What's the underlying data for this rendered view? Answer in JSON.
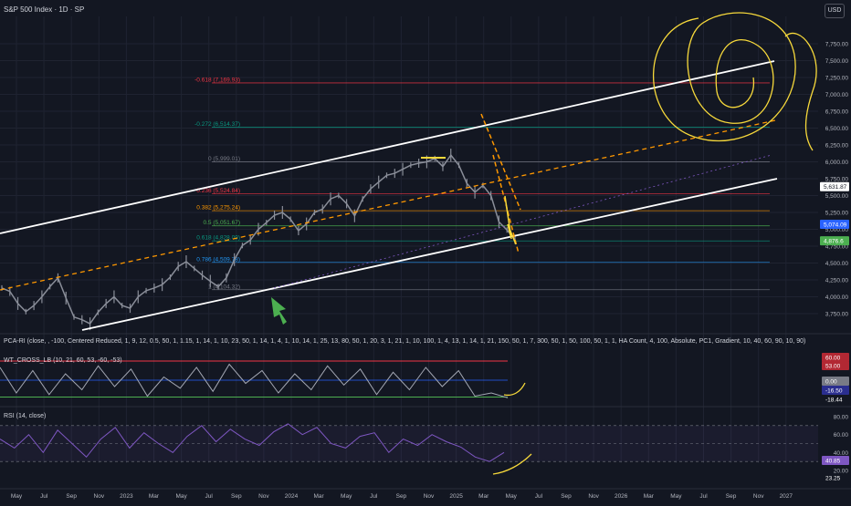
{
  "header": {
    "title": "S&P 500 Index · 1D · SP",
    "currency": "USD"
  },
  "chart_data": [
    {
      "type": "line",
      "title": "S&P 500 Index · 1D · SP",
      "x_ticks": [
        "May",
        "Jul",
        "Sep",
        "Nov",
        "2023",
        "Mar",
        "May",
        "Jul",
        "Sep",
        "Nov",
        "2024",
        "Mar",
        "May",
        "Jul",
        "Sep",
        "Nov",
        "2025",
        "Mar",
        "May",
        "Jul",
        "Sep",
        "Nov",
        "2026",
        "Mar",
        "May",
        "Jul",
        "Sep",
        "Nov",
        "2027"
      ],
      "y_ticks": [
        "7,750.00",
        "7,500.00",
        "7,250.00",
        "7,000.00",
        "6,750.00",
        "6,500.00",
        "6,250.00",
        "6,000.00",
        "5,750.00",
        "5,500.00",
        "5,250.00",
        "5,000.00",
        "4,750.00",
        "4,500.00",
        "4,250.00",
        "4,000.00",
        "3,750.00"
      ],
      "ylim": [
        3600,
        8050
      ],
      "series": [
        {
          "values": [
            4130,
            4080,
            3900,
            3780,
            3870,
            4000,
            4150,
            4280,
            3980,
            3700,
            3660,
            3600,
            3770,
            3900,
            4000,
            3870,
            3830,
            4000,
            4090,
            4130,
            4180,
            4290,
            4450,
            4520,
            4420,
            4320,
            4230,
            4150,
            4280,
            4550,
            4760,
            4840,
            5000,
            5100,
            5210,
            5250,
            5150,
            4980,
            5080,
            5250,
            5300,
            5450,
            5500,
            5380,
            5200,
            5450,
            5600,
            5700,
            5800,
            5830,
            5890,
            5950,
            5980,
            6000,
            6050,
            5930,
            6100,
            5950,
            5680,
            5550,
            5650,
            5500,
            5110,
            4990,
            4850
          ]
        }
      ],
      "fib_levels": [
        {
          "label": "-0.618 (7,169.93)",
          "value": 7169.93,
          "color": "#f23645"
        },
        {
          "label": "-0.272 (6,514.37)",
          "value": 6514.37,
          "color": "#089981"
        },
        {
          "label": "0 (5,999.01)",
          "value": 5999.01,
          "color": "#787b86"
        },
        {
          "label": "0.236 (5,524.84)",
          "value": 5524.84,
          "color": "#f23645"
        },
        {
          "label": "0.382 (5,275.24)",
          "value": 5275.24,
          "color": "#ff9800"
        },
        {
          "label": "0.5 (5,051.67)",
          "value": 5051.67,
          "color": "#4caf50"
        },
        {
          "label": "0.618 (4,828.09)",
          "value": 4828.09,
          "color": "#089981"
        },
        {
          "label": "0.786 (4,509.78)",
          "value": 4509.78,
          "color": "#2196f3"
        },
        {
          "label": "1 (4,104.32)",
          "value": 4104.32,
          "color": "#787b86"
        }
      ],
      "price_tags": [
        {
          "label": "5,631.87",
          "value": 5631.87,
          "bg": "#ffffff",
          "fg": "#131722"
        },
        {
          "label": "5,074.09",
          "value": 5074.09,
          "bg": "#2962ff",
          "fg": "#ffffff"
        },
        {
          "label": "4,876.6",
          "value": 4830,
          "bg": "#4caf50",
          "fg": "#ffffff"
        }
      ]
    },
    {
      "type": "line",
      "title": "WT_CROSS_LB (10, 21, 60, 53, -60, -53)",
      "levels": [
        60,
        53,
        0,
        -60,
        -53
      ],
      "series": [
        {
          "values": [
            40,
            -40,
            30,
            -45,
            20,
            -30,
            45,
            -20,
            35,
            -50,
            10,
            -25,
            40,
            -35,
            50,
            -10,
            30,
            -40,
            20,
            -30,
            45,
            -15,
            35,
            -45,
            25,
            -30,
            40,
            -20,
            30,
            -50,
            -40,
            -55
          ]
        }
      ],
      "tags": [
        {
          "label": "60.00",
          "bg": "#b22833"
        },
        {
          "label": "53.00",
          "bg": "#b22833"
        },
        {
          "label": "0.00",
          "bg": "#787b86"
        },
        {
          "label": "-16.50",
          "bg": "#2a2e8f"
        },
        {
          "label": "-18.44",
          "bg": "#131722"
        }
      ]
    },
    {
      "type": "line",
      "title": "RSI (14, close)",
      "y_ticks": [
        "80.00",
        "60.00",
        "40.00",
        "20.00"
      ],
      "ylim": [
        15,
        90
      ],
      "series": [
        {
          "values": [
            55,
            45,
            60,
            40,
            65,
            50,
            35,
            55,
            68,
            45,
            62,
            50,
            40,
            58,
            70,
            52,
            66,
            55,
            48,
            63,
            72,
            60,
            68,
            50,
            45,
            58,
            62,
            40,
            55,
            48,
            60,
            52,
            46,
            35,
            30,
            40
          ]
        }
      ],
      "tags": [
        {
          "label": "40.85",
          "bg": "#7e57c2"
        },
        {
          "label": "23.25",
          "bg": "#131722"
        }
      ]
    }
  ],
  "indicator_line": "PCA-RI (close, , -100, Centered Reduced, 1, 9, 12, 0.5, 50, 1, 1.15, 1, 14, 1, 10, 23, 50, 1, 14, 1, 4, 1, 10, 14, 1, 25, 13, 80, 50, 1, 20, 3, 1, 21, 1, 10, 100, 1, 4, 13, 1, 14, 1, 21, 150, 50, 1, 7, 300, 50, 1, 50, 100, 50, 1, 1, HA Count, 4, 100, Absolute, PC1, Gradient, 10, 40, 60, 90, 10, 90)",
  "colors": {
    "bg": "#131722",
    "grid": "#1f2331",
    "candles": "#8a8e99",
    "channel": "#ffffff",
    "dashed": "#ff9800",
    "drawing": "#f7d93b",
    "arrow": "#4caf50"
  }
}
